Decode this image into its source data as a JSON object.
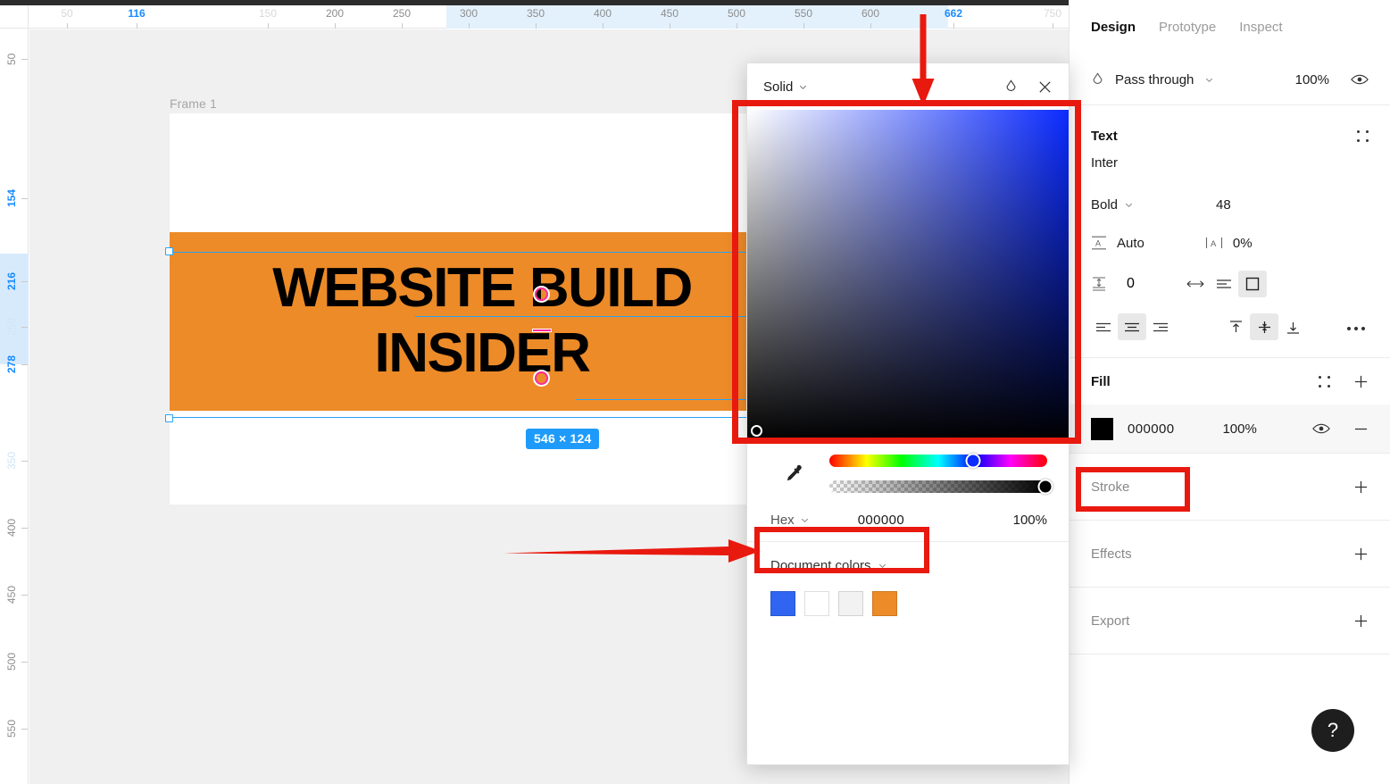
{
  "app": "Figma",
  "rulers": {
    "horizontal": [
      {
        "label": "50",
        "pos": 75,
        "style": "faint"
      },
      {
        "label": "116",
        "pos": 153,
        "style": "sel"
      },
      {
        "label": "150",
        "pos": 300,
        "style": "faint"
      },
      {
        "label": "200",
        "pos": 375,
        "style": "mid"
      },
      {
        "label": "250",
        "pos": 450,
        "style": "mid"
      },
      {
        "label": "300",
        "pos": 525,
        "style": "mid"
      },
      {
        "label": "350",
        "pos": 600,
        "style": "mid"
      },
      {
        "label": "400",
        "pos": 675,
        "style": "mid"
      },
      {
        "label": "450",
        "pos": 750,
        "style": "mid"
      },
      {
        "label": "500",
        "pos": 825,
        "style": "mid"
      },
      {
        "label": "550",
        "pos": 900,
        "style": "mid"
      },
      {
        "label": "600",
        "pos": 975,
        "style": "mid"
      },
      {
        "label": "662",
        "pos": 1068,
        "style": "sel"
      },
      {
        "label": "750",
        "pos": 1179,
        "style": "faint"
      }
    ],
    "vertical": [
      {
        "label": "50",
        "pos": 34,
        "style": "mid"
      },
      {
        "label": "154",
        "pos": 190,
        "style": "sel"
      },
      {
        "label": "216",
        "pos": 283,
        "style": "sel"
      },
      {
        "label": "250",
        "pos": 334,
        "style": "faint"
      },
      {
        "label": "278",
        "pos": 376,
        "style": "sel"
      },
      {
        "label": "350",
        "pos": 484,
        "style": "faint"
      },
      {
        "label": "400",
        "pos": 559,
        "style": "mid"
      },
      {
        "label": "450",
        "pos": 634,
        "style": "mid"
      },
      {
        "label": "500",
        "pos": 709,
        "style": "mid"
      },
      {
        "label": "550",
        "pos": 784,
        "style": "mid"
      }
    ]
  },
  "canvas": {
    "frame_label": "Frame 1",
    "banner_color": "#ED8B28",
    "headline_line1": "WEBSITE BUILD",
    "headline_line2": "INSIDER",
    "headline_color": "#000000",
    "size_badge": "546 × 124"
  },
  "color_picker": {
    "type_label": "Solid",
    "eyedropper_icon": "eyedropper-icon",
    "close_icon": "close-icon",
    "blend_icon": "blend-mode-icon",
    "format_label": "Hex",
    "hex_value": "000000",
    "opacity": "100%",
    "document_colors_label": "Document colors",
    "document_colors": [
      "#2F65F0",
      "#FFFFFF",
      "#F2F2F2",
      "#ED8B28"
    ]
  },
  "right_panel": {
    "tabs": [
      {
        "label": "Design",
        "active": true
      },
      {
        "label": "Prototype",
        "active": false
      },
      {
        "label": "Inspect",
        "active": false
      }
    ],
    "blend": {
      "icon": "blend-mode-icon",
      "mode": "Pass through",
      "opacity": "100%",
      "visibility_icon": "eye-icon"
    },
    "text_section": {
      "title": "Text",
      "settings_icon": "text-settings-icon",
      "font_family": "Inter",
      "font_weight": "Bold",
      "font_size": "48",
      "line_height": "Auto",
      "line_height_icon": "line-height-icon",
      "letter_spacing": "0%",
      "letter_spacing_icon": "letter-spacing-icon",
      "paragraph_spacing": "0",
      "paragraph_spacing_icon": "paragraph-spacing-icon",
      "resize_icons": [
        "auto-width-icon",
        "auto-height-icon",
        "fixed-size-icon"
      ],
      "resize_active": 2,
      "align_h_icons": [
        "align-left-icon",
        "align-center-icon",
        "align-right-icon"
      ],
      "align_h_active": 1,
      "align_v_icons": [
        "align-top-icon",
        "align-middle-icon",
        "align-bottom-icon"
      ],
      "align_v_active": 1,
      "more_icon": "more-options-icon"
    },
    "fill_section": {
      "title": "Fill",
      "styles_icon": "fill-styles-icon",
      "add_icon": "add-icon",
      "swatch_color": "#000000",
      "hex": "000000",
      "opacity": "100%",
      "visibility_icon": "eye-icon",
      "remove_icon": "remove-icon"
    },
    "stroke_section": {
      "title": "Stroke",
      "add_icon": "add-icon"
    },
    "effects_section": {
      "title": "Effects",
      "add_icon": "add-icon"
    },
    "export_section": {
      "title": "Export",
      "add_icon": "add-icon"
    },
    "help_button": "?"
  },
  "annotations": {
    "accent_color": "#E8190F",
    "boxes": [
      "color-picker-area",
      "hex-input-field",
      "fill-swatch-row"
    ],
    "arrows": [
      "arrow-down-to-picker",
      "arrow-right-to-hex"
    ]
  }
}
